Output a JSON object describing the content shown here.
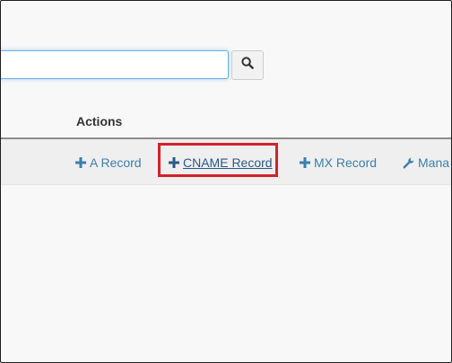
{
  "search": {
    "value": "",
    "placeholder": ""
  },
  "search_button": {
    "icon": "search-icon"
  },
  "table": {
    "header": {
      "actions_label": "Actions"
    }
  },
  "actions": {
    "a_record": {
      "label": "A Record",
      "icon": "plus-icon"
    },
    "cname_record": {
      "label": "CNAME Record",
      "icon": "plus-icon",
      "highlighted": true
    },
    "mx_record": {
      "label": "MX Record",
      "icon": "plus-icon"
    },
    "manage": {
      "label": "Mana",
      "icon": "wrench-icon"
    }
  },
  "colors": {
    "link": "#3b7fb0",
    "highlight": "#d3212d",
    "focus_border": "#66afe9"
  }
}
